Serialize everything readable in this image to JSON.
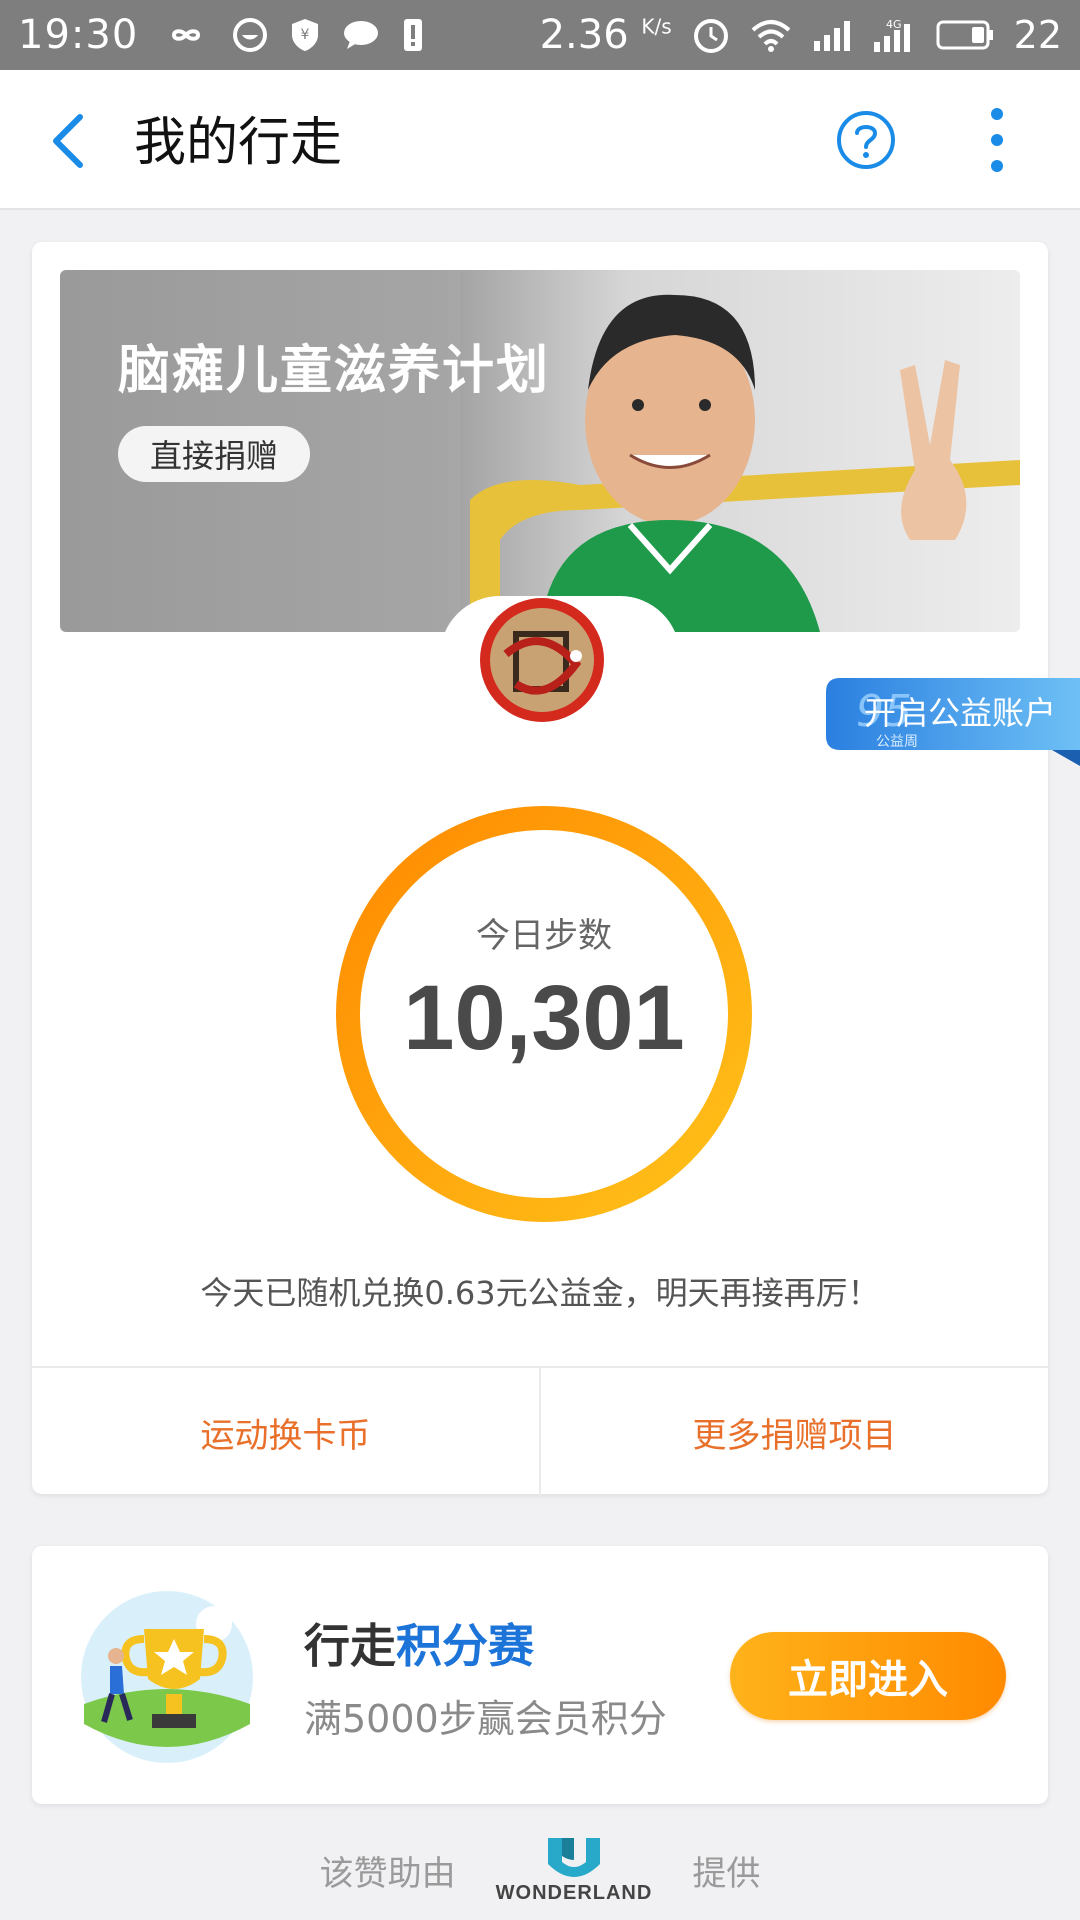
{
  "status_bar": {
    "time": "19:30",
    "speed": "2.36",
    "speed_unit": "K/s",
    "network": "4G",
    "battery": "22"
  },
  "app_bar": {
    "title": "我的行走"
  },
  "banner": {
    "title": "脑瘫儿童滋养计划",
    "donate_label": "直接捐赠"
  },
  "charity_tag": {
    "label": "开启公益账户",
    "badge_number": "95",
    "badge_caption": "公益周"
  },
  "steps": {
    "label": "今日步数",
    "value": "10,301"
  },
  "exchange_message": "今天已随机兑换0.63元公益金，明天再接再厉！",
  "actions": [
    {
      "label": "运动换卡币"
    },
    {
      "label": "更多捐赠项目"
    }
  ],
  "promo": {
    "title_prefix": "行走",
    "title_accent": "积分赛",
    "subtitle": "满5000步赢会员积分",
    "button_label": "立即进入"
  },
  "footer": {
    "left": "该赞助由",
    "brand": "WONDERLAND",
    "right": "提供"
  },
  "colors": {
    "accent_blue": "#1a8ce8",
    "action_orange": "#e8702a",
    "ring_start": "#ff8a00",
    "ring_end": "#ffc21a"
  }
}
